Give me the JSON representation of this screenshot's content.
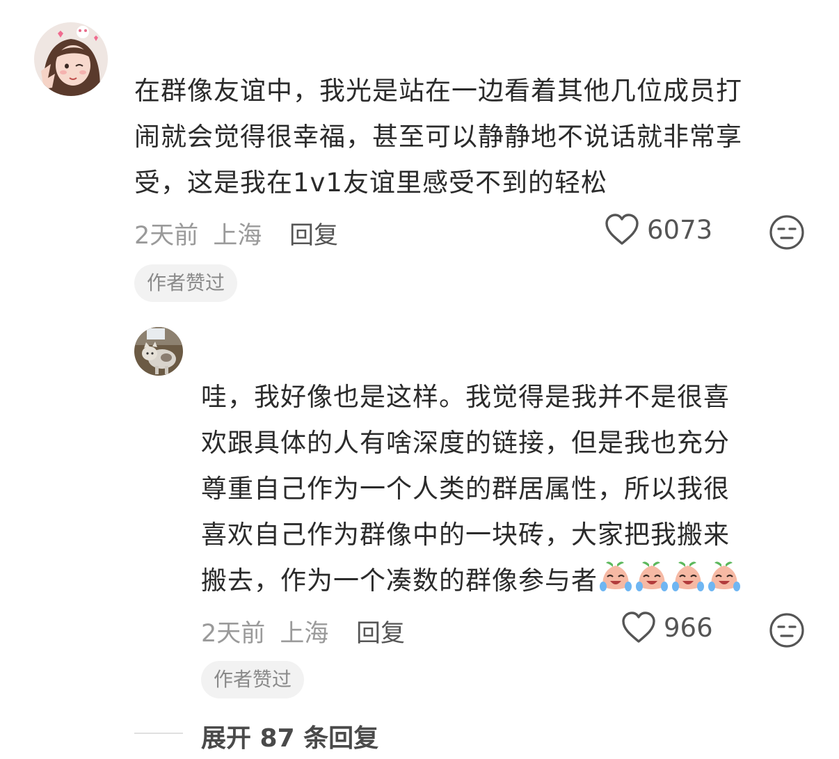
{
  "comments": [
    {
      "text_lines": [
        "在群像友谊中，我光是站在一边看着其他几位成员打",
        "闹就会觉得很幸福，甚至可以静静地不说话就非常享",
        "受，这是我在1v1友谊里感受不到的轻松"
      ],
      "time": "2天前",
      "location": "上海",
      "reply_label": "回复",
      "likes": "6073",
      "badge": "作者赞过",
      "avatar_icon": "avatar-girl-icon"
    },
    {
      "text_lines": [
        "哇，我好像也是这样。我觉得是我并不是很喜",
        "欢跟具体的人有啥深度的链接，但是我也充分",
        "尊重自己作为一个人类的群居属性，所以我很",
        "喜欢自己作为群像中的一块砖，大家把我搬来",
        "搬去，作为一个凑数的群像参与者"
      ],
      "emoji": "crying-laughing-peach-icon",
      "emoji_count": 4,
      "time": "2天前",
      "location": "上海",
      "reply_label": "回复",
      "likes": "966",
      "badge": "作者赞过",
      "avatar_icon": "avatar-cat-icon"
    }
  ],
  "expand_label": "展开 87 条回复",
  "colors": {
    "text": "#2b2b2b",
    "meta": "#9a9a9a",
    "badge_bg": "#f2f2f2"
  }
}
